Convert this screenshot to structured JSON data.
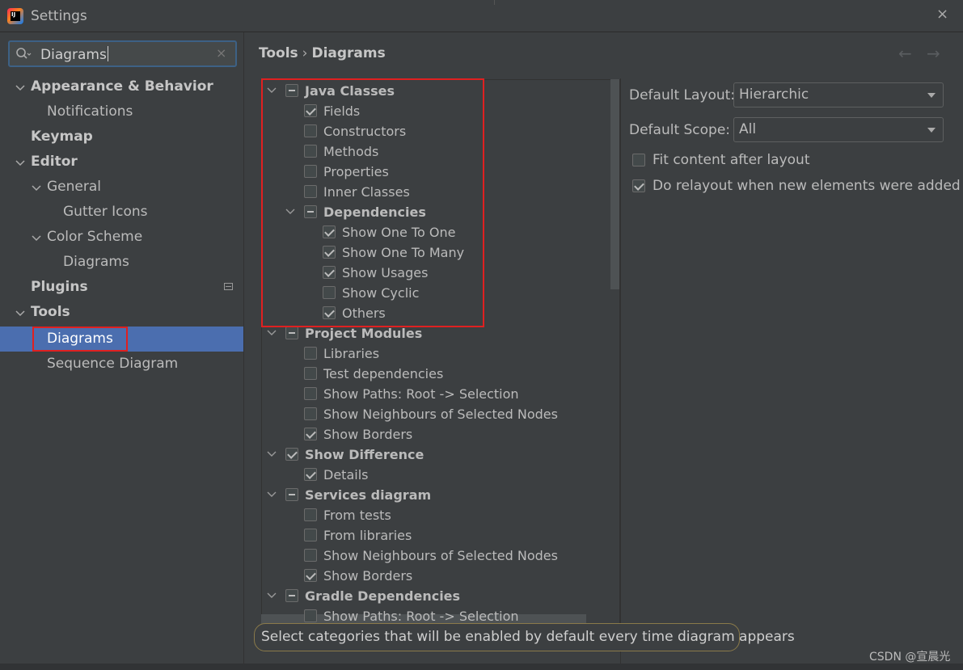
{
  "window": {
    "title": "Settings",
    "close": "×"
  },
  "search": {
    "value": "Diagrams",
    "clear": "×"
  },
  "sidebar": {
    "items": [
      {
        "label": "Appearance & Behavior"
      },
      {
        "label": "Notifications"
      },
      {
        "label": "Keymap"
      },
      {
        "label": "Editor"
      },
      {
        "label": "General"
      },
      {
        "label": "Gutter Icons"
      },
      {
        "label": "Color Scheme"
      },
      {
        "label": "Diagrams"
      },
      {
        "label": "Plugins"
      },
      {
        "label": "Tools"
      },
      {
        "label": "Diagrams"
      },
      {
        "label": "Sequence Diagram"
      }
    ]
  },
  "breadcrumb": {
    "parent": "Tools",
    "separator": "›",
    "current": "Diagrams",
    "back": "←",
    "forward": "→"
  },
  "tree": {
    "groups": [
      {
        "label": "Java Classes",
        "state": "partial",
        "items": [
          {
            "label": "Fields",
            "checked": true
          },
          {
            "label": "Constructors",
            "checked": false
          },
          {
            "label": "Methods",
            "checked": false
          },
          {
            "label": "Properties",
            "checked": false
          },
          {
            "label": "Inner Classes",
            "checked": false
          }
        ]
      },
      {
        "label": "Dependencies",
        "state": "partial",
        "items": [
          {
            "label": "Show One To One",
            "checked": true
          },
          {
            "label": "Show One To Many",
            "checked": true
          },
          {
            "label": "Show Usages",
            "checked": true
          },
          {
            "label": "Show Cyclic",
            "checked": false
          },
          {
            "label": "Others",
            "checked": true
          }
        ]
      },
      {
        "label": "Project Modules",
        "state": "partial",
        "items": [
          {
            "label": "Libraries",
            "checked": false
          },
          {
            "label": "Test dependencies",
            "checked": false
          },
          {
            "label": "Show Paths: Root -> Selection",
            "checked": false
          },
          {
            "label": "Show Neighbours of Selected Nodes",
            "checked": false
          },
          {
            "label": "Show Borders",
            "checked": true
          }
        ]
      },
      {
        "label": "Show Difference",
        "state": "checked",
        "items": [
          {
            "label": "Details",
            "checked": true
          }
        ]
      },
      {
        "label": "Services diagram",
        "state": "partial",
        "items": [
          {
            "label": "From tests",
            "checked": false
          },
          {
            "label": "From libraries",
            "checked": false
          },
          {
            "label": "Show Neighbours of Selected Nodes",
            "checked": false
          },
          {
            "label": "Show Borders",
            "checked": true
          }
        ]
      },
      {
        "label": "Gradle Dependencies",
        "state": "partial",
        "items": [
          {
            "label": "Show Paths: Root -> Selection",
            "checked": false
          }
        ]
      }
    ]
  },
  "options": {
    "layout_label": "Default Layout:",
    "layout_value": "Hierarchic",
    "scope_label": "Default Scope:",
    "scope_value": "All",
    "fit_label": "Fit content after layout",
    "fit_checked": false,
    "relayout_label": "Do relayout when new elements were added",
    "relayout_checked": true
  },
  "tooltip": "Select categories that will be enabled by default every time diagram appears",
  "watermark": "CSDN @宣晨光"
}
